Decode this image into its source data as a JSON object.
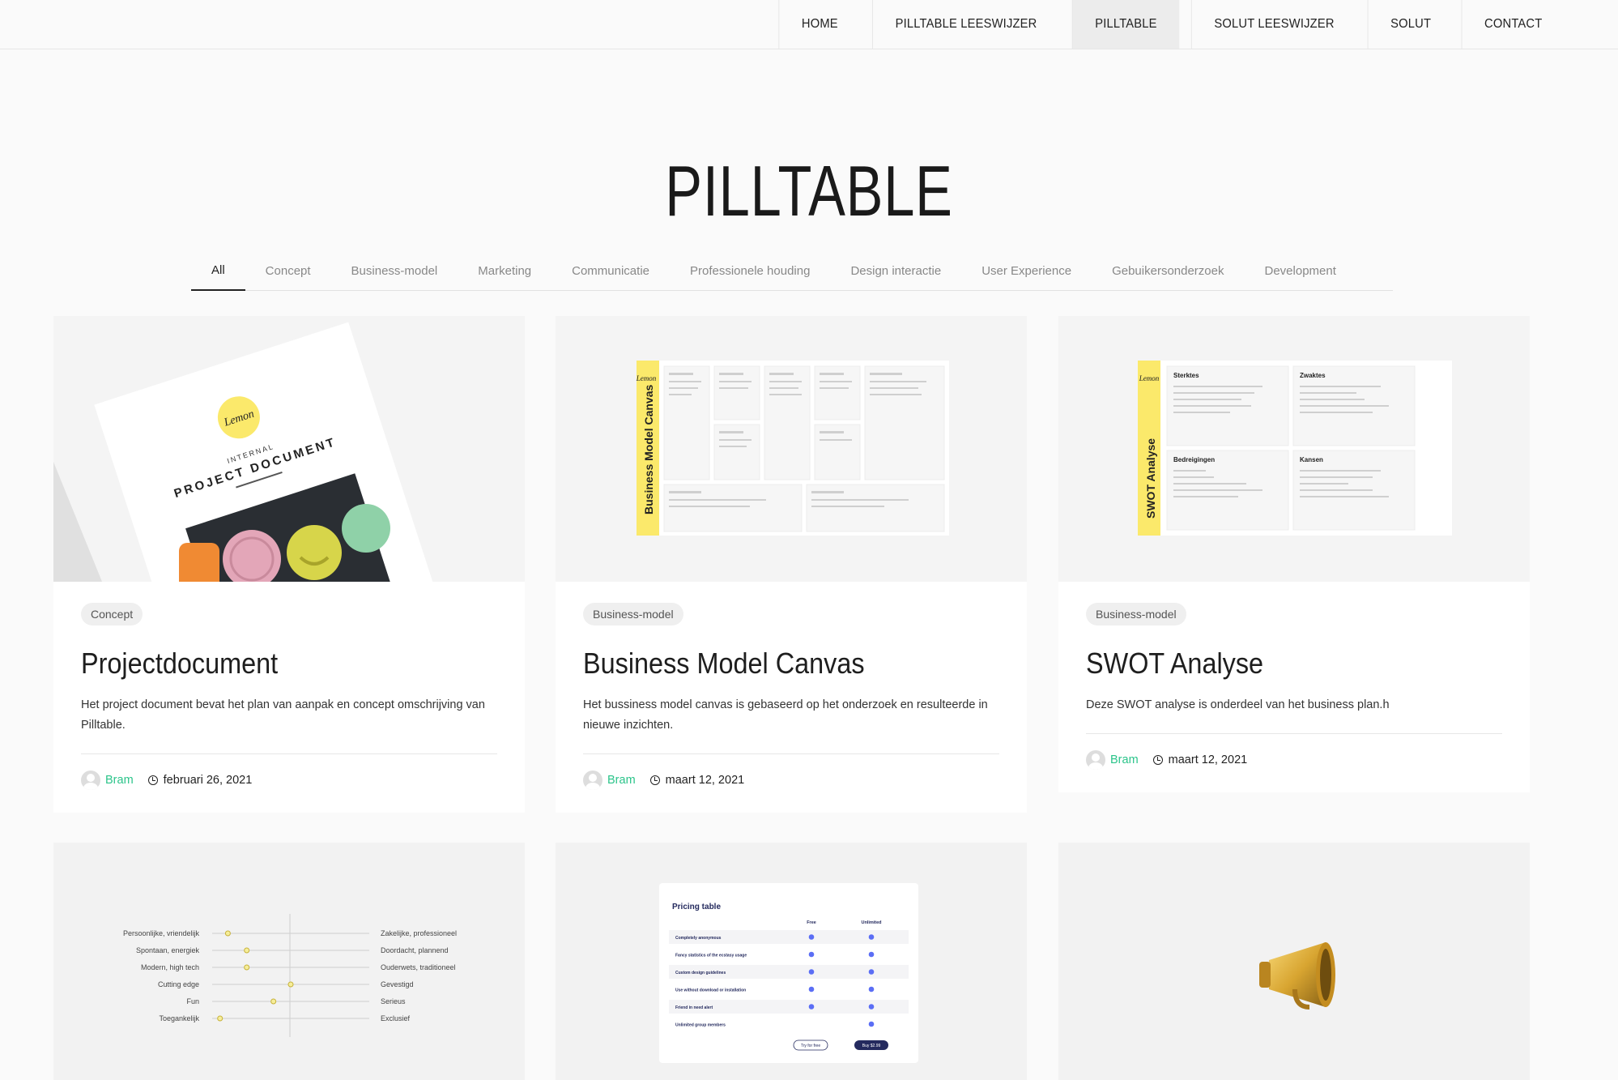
{
  "nav": [
    {
      "label": "HOME",
      "active": false
    },
    {
      "label": "PILLTABLE LEESWIJZER",
      "active": false
    },
    {
      "label": "PILLTABLE",
      "active": true
    },
    {
      "label": "SOLUT LEESWIJZER",
      "active": false
    },
    {
      "label": "SOLUT",
      "active": false
    },
    {
      "label": "CONTACT",
      "active": false
    }
  ],
  "page_title": "PILLTABLE",
  "filters": [
    "All",
    "Concept",
    "Business-model",
    "Marketing",
    "Communicatie",
    "Professionele houding",
    "Design interactie",
    "User Experience",
    "Gebuikersonderzoek",
    "Development"
  ],
  "active_filter": "All",
  "cards": [
    {
      "tag": "Concept",
      "title": "Projectdocument",
      "excerpt": "Het project document bevat het plan van aanpak en concept omschrijving van Pilltable.",
      "author": "Bram",
      "date": "februari 26, 2021",
      "thumb": {
        "brand": "Lemon",
        "kicker": "INTERNAL",
        "heading": "PROJECT DOCUMENT"
      }
    },
    {
      "tag": "Business-model",
      "title": "Business Model Canvas",
      "excerpt": "Het bussiness model canvas is gebaseerd op het onderzoek en resulteerde in nieuwe inzichten.",
      "author": "Bram",
      "date": "maart 12, 2021",
      "thumb": {
        "brand": "Lemon",
        "side_title": "Business Model Canvas"
      }
    },
    {
      "tag": "Business-model",
      "title": "SWOT Analyse",
      "excerpt": "Deze SWOT analyse is onderdeel van het business plan.h",
      "author": "Bram",
      "date": "maart 12, 2021",
      "thumb": {
        "brand": "Lemon",
        "side_title": "SWOT Analyse",
        "quadrants": [
          "Sterktes",
          "Zwaktes",
          "Bedreigingen",
          "Kansen"
        ]
      }
    }
  ],
  "row2": {
    "scales": [
      {
        "left": "Persoonlijke, vriendelijk",
        "right": "Zakelijke, professioneel",
        "value": 0.1
      },
      {
        "left": "Spontaan, energiek",
        "right": "Doordacht, plannend",
        "value": 0.22
      },
      {
        "left": "Modern, high tech",
        "right": "Ouderwets, traditioneel",
        "value": 0.22
      },
      {
        "left": "Cutting edge",
        "right": "Gevestigd",
        "value": 0.5
      },
      {
        "left": "Fun",
        "right": "Serieus",
        "value": 0.39
      },
      {
        "left": "Toegankelijk",
        "right": "Exclusief",
        "value": 0.05
      }
    ],
    "pricing": {
      "title": "Pricing table",
      "columns": [
        "Free",
        "Unlimited"
      ],
      "rows": [
        {
          "label": "Completely anonymous",
          "free": true,
          "unlimited": true
        },
        {
          "label": "Fancy statistics of the ecstasy usage",
          "free": true,
          "unlimited": true
        },
        {
          "label": "Custom design guidelines",
          "free": true,
          "unlimited": true
        },
        {
          "label": "Use without download or installation",
          "free": true,
          "unlimited": true
        },
        {
          "label": "Friend in need alert",
          "free": true,
          "unlimited": true
        },
        {
          "label": "Unlimited group members",
          "free": false,
          "unlimited": true
        }
      ],
      "buttons": [
        "Try for free",
        "Buy $2.99"
      ]
    },
    "icon": "megaphone-icon"
  },
  "colors": {
    "accent": "#2bc48a",
    "lemon": "#fbe96b",
    "dot": "#5b6ef5",
    "navy": "#242a5e"
  }
}
